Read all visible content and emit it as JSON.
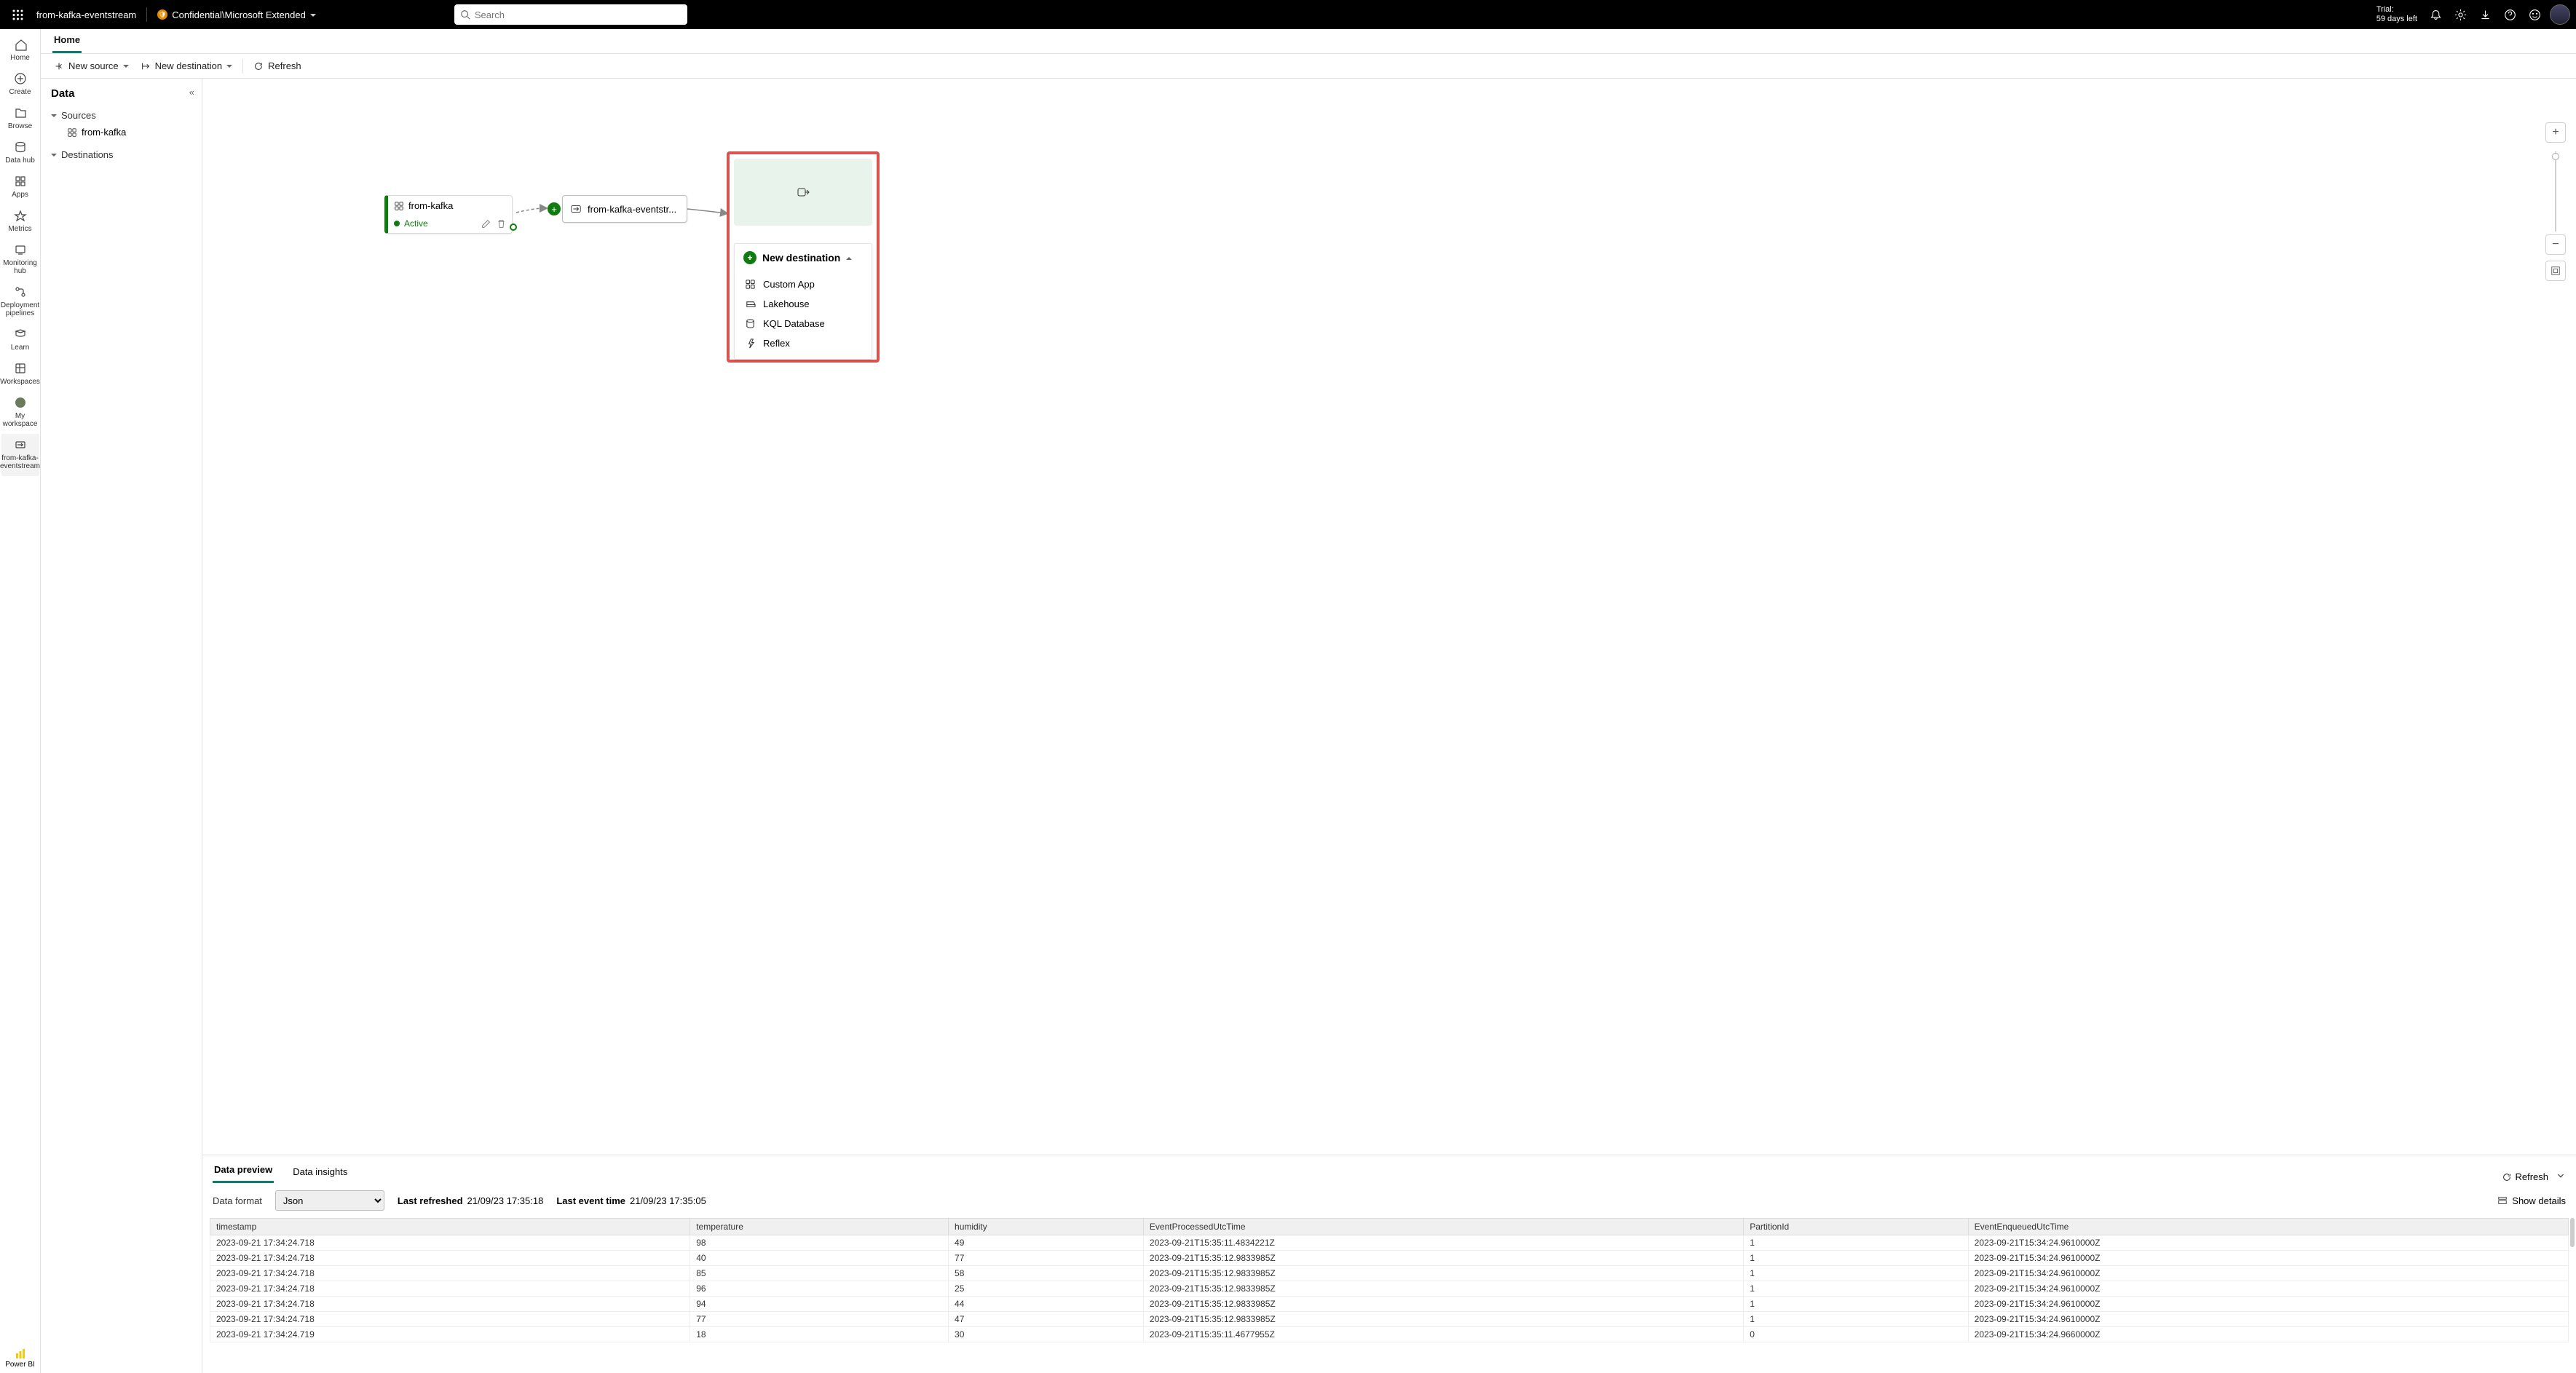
{
  "topbar": {
    "item_name": "from-kafka-eventstream",
    "confidentiality": "Confidential\\Microsoft Extended",
    "search_placeholder": "Search",
    "trial_l1": "Trial:",
    "trial_l2": "59 days left"
  },
  "leftrail": {
    "items": [
      {
        "id": "home",
        "label": "Home"
      },
      {
        "id": "create",
        "label": "Create"
      },
      {
        "id": "browse",
        "label": "Browse"
      },
      {
        "id": "datahub",
        "label": "Data hub"
      },
      {
        "id": "apps",
        "label": "Apps"
      },
      {
        "id": "metrics",
        "label": "Metrics"
      },
      {
        "id": "monitoring",
        "label": "Monitoring hub"
      },
      {
        "id": "pipelines",
        "label": "Deployment pipelines"
      },
      {
        "id": "learn",
        "label": "Learn"
      },
      {
        "id": "workspaces",
        "label": "Workspaces"
      },
      {
        "id": "myws",
        "label": "My workspace"
      },
      {
        "id": "current",
        "label": "from-kafka-eventstream",
        "active": true
      }
    ],
    "footer": "Power BI"
  },
  "tabbar": {
    "home": "Home"
  },
  "cmdbar": {
    "new_source": "New source",
    "new_dest": "New destination",
    "refresh": "Refresh"
  },
  "sidepanel": {
    "title": "Data",
    "group_sources": "Sources",
    "source_item": "from-kafka",
    "group_destinations": "Destinations"
  },
  "canvas": {
    "source_name": "from-kafka",
    "source_status": "Active",
    "stream_name": "from-kafka-eventstr...",
    "new_dest_label": "New destination",
    "dest_options": [
      "Custom App",
      "Lakehouse",
      "KQL Database",
      "Reflex"
    ]
  },
  "bottom": {
    "tab_preview": "Data preview",
    "tab_insights": "Data insights",
    "refresh": "Refresh",
    "fmt_label": "Data format",
    "fmt_value": "Json",
    "last_refreshed_l": "Last refreshed",
    "last_refreshed_v": "21/09/23 17:35:18",
    "last_event_l": "Last event time",
    "last_event_v": "21/09/23 17:35:05",
    "show_details": "Show details",
    "columns": [
      "timestamp",
      "temperature",
      "humidity",
      "EventProcessedUtcTime",
      "PartitionId",
      "EventEnqueuedUtcTime"
    ],
    "rows": [
      [
        "2023-09-21 17:34:24.718",
        "98",
        "49",
        "2023-09-21T15:35:11.4834221Z",
        "1",
        "2023-09-21T15:34:24.9610000Z"
      ],
      [
        "2023-09-21 17:34:24.718",
        "40",
        "77",
        "2023-09-21T15:35:12.9833985Z",
        "1",
        "2023-09-21T15:34:24.9610000Z"
      ],
      [
        "2023-09-21 17:34:24.718",
        "85",
        "58",
        "2023-09-21T15:35:12.9833985Z",
        "1",
        "2023-09-21T15:34:24.9610000Z"
      ],
      [
        "2023-09-21 17:34:24.718",
        "96",
        "25",
        "2023-09-21T15:35:12.9833985Z",
        "1",
        "2023-09-21T15:34:24.9610000Z"
      ],
      [
        "2023-09-21 17:34:24.718",
        "94",
        "44",
        "2023-09-21T15:35:12.9833985Z",
        "1",
        "2023-09-21T15:34:24.9610000Z"
      ],
      [
        "2023-09-21 17:34:24.718",
        "77",
        "47",
        "2023-09-21T15:35:12.9833985Z",
        "1",
        "2023-09-21T15:34:24.9610000Z"
      ],
      [
        "2023-09-21 17:34:24.719",
        "18",
        "30",
        "2023-09-21T15:35:11.4677955Z",
        "0",
        "2023-09-21T15:34:24.9660000Z"
      ]
    ]
  }
}
